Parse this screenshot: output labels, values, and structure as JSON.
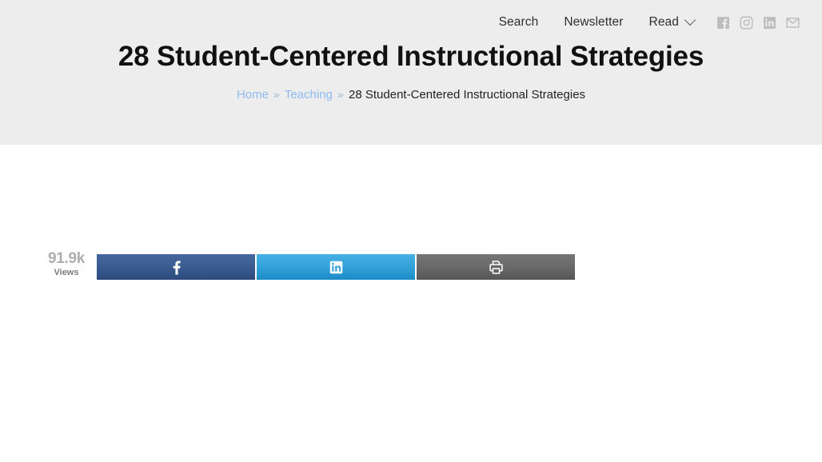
{
  "header": {
    "nav": [
      {
        "label": "Search",
        "name": "nav-search",
        "caret": false
      },
      {
        "label": "Newsletter",
        "name": "nav-newsletter",
        "caret": false
      },
      {
        "label": "Read",
        "name": "nav-read",
        "caret": true
      }
    ],
    "social": [
      {
        "icon": "facebook-icon",
        "label": "Facebook"
      },
      {
        "icon": "instagram-icon",
        "label": "Instagram"
      },
      {
        "icon": "linkedin-icon",
        "label": "LinkedIn"
      },
      {
        "icon": "email-icon",
        "label": "Email"
      }
    ],
    "title": "28 Student-Centered Instructional Strategies",
    "breadcrumb": {
      "home": "Home",
      "sep1": "»",
      "category": "Teaching",
      "sep2": "»",
      "current": "28 Student-Centered Instructional Strategies"
    }
  },
  "share_bar": {
    "views_count": "91.9k",
    "views_label": "Views",
    "buttons": [
      {
        "name": "share-facebook-button",
        "icon": "facebook-icon"
      },
      {
        "name": "share-linkedin-button",
        "icon": "linkedin-icon"
      },
      {
        "name": "print-button",
        "icon": "printer-icon"
      }
    ]
  },
  "colors": {
    "header_background": "#ededed",
    "page_background": "#ffffff",
    "title_text": "#111111",
    "link_blue": "#8ebaf0",
    "facebook_blue": "#3b5d92",
    "linkedin_blue": "#35a3da",
    "print_grey": "#6b6b6b",
    "social_icon_grey": "#bdbdbd",
    "views_count_grey": "#aeaeae",
    "views_label_grey": "#7b7b7b"
  }
}
